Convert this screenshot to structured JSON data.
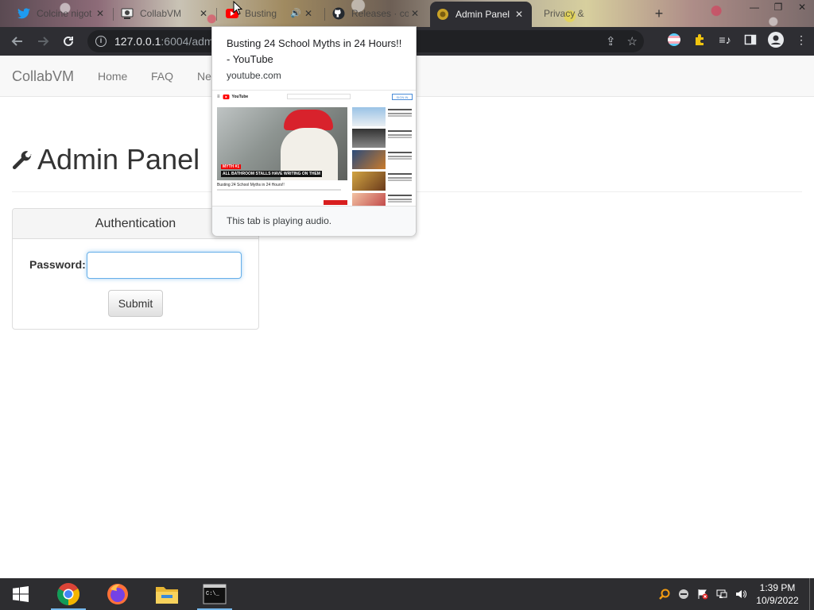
{
  "browser": {
    "tabs": [
      {
        "label": "Colcine nigot",
        "icon": "twitter-icon",
        "active": false
      },
      {
        "label": "CollabVM",
        "icon": "collabvm-icon",
        "active": false
      },
      {
        "label": "Busting",
        "icon": "youtube-icon",
        "active": false,
        "audio": true
      },
      {
        "label": "Releases · co",
        "icon": "github-icon",
        "active": false
      },
      {
        "label": "Admin Panel",
        "icon": "collabvm-gold-icon",
        "active": true
      },
      {
        "label": "Privacy &",
        "icon": "privacy-icon",
        "active": false
      }
    ],
    "url_host": "127.0.0.1",
    "url_rest": ":6004/admi",
    "colors": {
      "toolbar": "#2e2e33",
      "active_tab": "#2e2e33"
    }
  },
  "hovercard": {
    "title": "Busting 24 School Myths in 24 Hours!! - YouTube",
    "domain": "youtube.com",
    "preview_video_caption": "ALL BATHROOM STALLS HAVE WRITING ON THEM",
    "preview_badge": "MYTH #1",
    "preview_video_title": "Busting 24 School Myths in 24 Hours!!",
    "preview_yt_label": "YouTube",
    "preview_signin": "SIGN IN",
    "footer": "This tab is playing audio."
  },
  "site": {
    "brand": "CollabVM",
    "nav": [
      "Home",
      "FAQ",
      "Ne"
    ],
    "heading": "Admin Panel",
    "panel_title": "Authentication",
    "password_label": "Password:",
    "password_value": "",
    "submit_label": "Submit"
  },
  "taskbar": {
    "apps": [
      "chrome-icon",
      "firefox-icon",
      "file-explorer-icon",
      "command-prompt-icon"
    ],
    "time": "1:39 PM",
    "date": "10/9/2022"
  }
}
